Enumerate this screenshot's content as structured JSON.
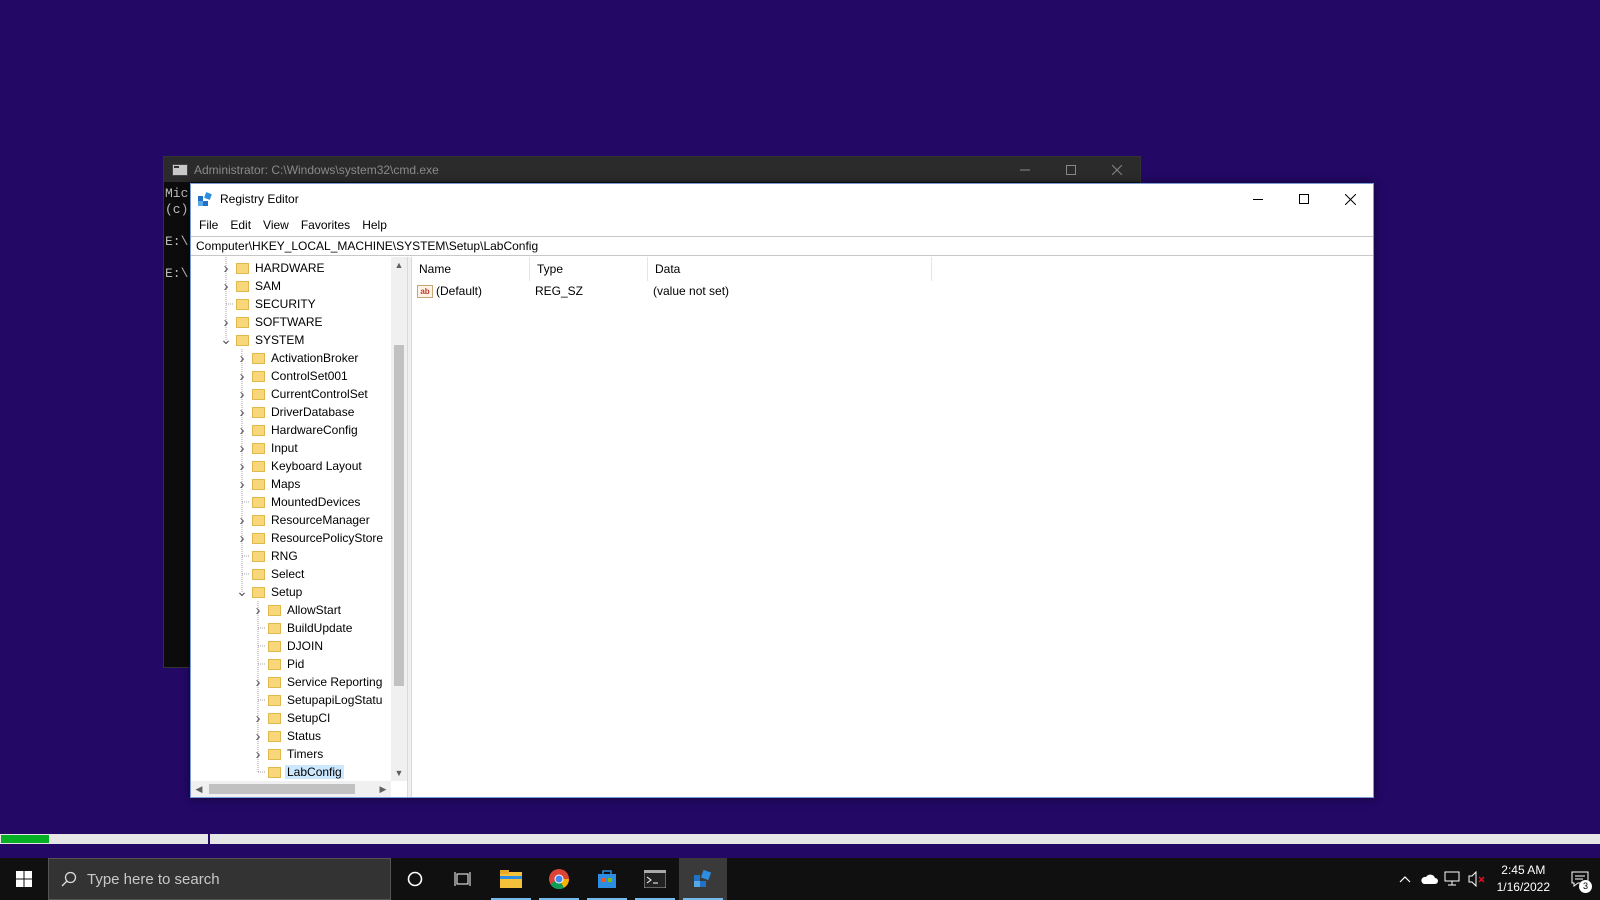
{
  "cmd": {
    "title": "Administrator: C:\\Windows\\system32\\cmd.exe",
    "lines": [
      "Mic",
      "(c)",
      "",
      "E:\\",
      "",
      "E:\\"
    ]
  },
  "regedit": {
    "title": "Registry Editor",
    "menu": [
      "File",
      "Edit",
      "View",
      "Favorites",
      "Help"
    ],
    "address": "Computer\\HKEY_LOCAL_MACHINE\\SYSTEM\\Setup\\LabConfig",
    "tree": [
      {
        "label": "HARDWARE",
        "level": 1,
        "expander": "collapsed"
      },
      {
        "label": "SAM",
        "level": 1,
        "expander": "collapsed"
      },
      {
        "label": "SECURITY",
        "level": 1,
        "expander": "none"
      },
      {
        "label": "SOFTWARE",
        "level": 1,
        "expander": "collapsed"
      },
      {
        "label": "SYSTEM",
        "level": 1,
        "expander": "expanded"
      },
      {
        "label": "ActivationBroker",
        "level": 2,
        "expander": "collapsed"
      },
      {
        "label": "ControlSet001",
        "level": 2,
        "expander": "collapsed"
      },
      {
        "label": "CurrentControlSet",
        "level": 2,
        "expander": "collapsed"
      },
      {
        "label": "DriverDatabase",
        "level": 2,
        "expander": "collapsed"
      },
      {
        "label": "HardwareConfig",
        "level": 2,
        "expander": "collapsed"
      },
      {
        "label": "Input",
        "level": 2,
        "expander": "collapsed"
      },
      {
        "label": "Keyboard Layout",
        "level": 2,
        "expander": "collapsed"
      },
      {
        "label": "Maps",
        "level": 2,
        "expander": "collapsed"
      },
      {
        "label": "MountedDevices",
        "level": 2,
        "expander": "none"
      },
      {
        "label": "ResourceManager",
        "level": 2,
        "expander": "collapsed"
      },
      {
        "label": "ResourcePolicyStore",
        "level": 2,
        "expander": "collapsed"
      },
      {
        "label": "RNG",
        "level": 2,
        "expander": "none"
      },
      {
        "label": "Select",
        "level": 2,
        "expander": "none"
      },
      {
        "label": "Setup",
        "level": 2,
        "expander": "expanded"
      },
      {
        "label": "AllowStart",
        "level": 3,
        "expander": "collapsed"
      },
      {
        "label": "BuildUpdate",
        "level": 3,
        "expander": "none"
      },
      {
        "label": "DJOIN",
        "level": 3,
        "expander": "none"
      },
      {
        "label": "Pid",
        "level": 3,
        "expander": "none"
      },
      {
        "label": "Service Reporting",
        "level": 3,
        "expander": "collapsed"
      },
      {
        "label": "SetupapiLogStatu",
        "level": 3,
        "expander": "none"
      },
      {
        "label": "SetupCI",
        "level": 3,
        "expander": "collapsed"
      },
      {
        "label": "Status",
        "level": 3,
        "expander": "collapsed"
      },
      {
        "label": "Timers",
        "level": 3,
        "expander": "collapsed"
      },
      {
        "label": "LabConfig",
        "level": 3,
        "expander": "none",
        "selected": true
      }
    ],
    "columns": {
      "name": "Name",
      "type": "Type",
      "data": "Data"
    },
    "values": [
      {
        "name": "(Default)",
        "type": "REG_SZ",
        "data": "(value not set)",
        "icon": "ab-string-icon"
      }
    ]
  },
  "progress": {
    "value_percent": 3
  },
  "taskbar": {
    "search_placeholder": "Type here to search",
    "apps": [
      "cortana-icon",
      "task-view-icon",
      "file-explorer-icon",
      "chrome-icon",
      "store-icon",
      "cmd-icon",
      "regedit-icon"
    ],
    "time": "2:45 AM",
    "date": "1/16/2022",
    "notification_count": "3"
  },
  "colors": {
    "desktop": "#230865",
    "taskbar": "#101010",
    "progress_fill": "#06b025",
    "selection": "#cce8ff"
  }
}
